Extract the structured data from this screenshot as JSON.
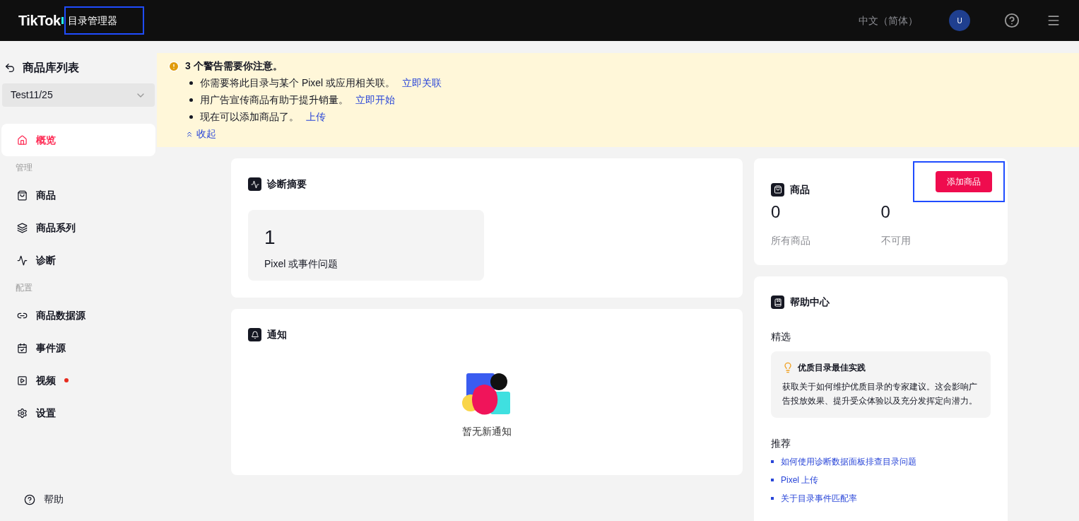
{
  "header": {
    "logo": "TikTok",
    "title": "目录管理器",
    "title_highlighted": true,
    "language": "中文（简体）",
    "avatar": "U"
  },
  "sidebar": {
    "back_label": "商品库列表",
    "catalog_select": "Test11/25",
    "items": [
      {
        "kind": "item",
        "label": "概览",
        "selected": true,
        "dot": false
      },
      {
        "kind": "section",
        "label": "管理"
      },
      {
        "kind": "item",
        "label": "商品",
        "selected": false,
        "dot": false
      },
      {
        "kind": "item",
        "label": "商品系列",
        "selected": false,
        "dot": false
      },
      {
        "kind": "item",
        "label": "诊断",
        "selected": false,
        "dot": false
      },
      {
        "kind": "section",
        "label": "配置"
      },
      {
        "kind": "item",
        "label": "商品数据源",
        "selected": false,
        "dot": false
      },
      {
        "kind": "item",
        "label": "事件源",
        "selected": false,
        "dot": false
      },
      {
        "kind": "item",
        "label": "视频",
        "selected": false,
        "dot": true
      },
      {
        "kind": "item",
        "label": "设置",
        "selected": false,
        "dot": false
      }
    ],
    "help": "帮助"
  },
  "alert": {
    "title": "3 个警告需要你注意。",
    "items": [
      {
        "text": "你需要将此目录与某个 Pixel 或应用相关联。",
        "link": "立即关联"
      },
      {
        "text": "用广告宣传商品有助于提升销量。",
        "link": "立即开始"
      },
      {
        "text": "现在可以添加商品了。",
        "link": "上传"
      }
    ],
    "collapse": "收起"
  },
  "diagnostics": {
    "title": "诊断摘要",
    "count": "1",
    "label": "Pixel 或事件问题"
  },
  "notifications": {
    "title": "通知",
    "empty": "暂无新通知"
  },
  "products": {
    "title": "商品",
    "add_button": "添加商品",
    "button_highlighted": true,
    "stats": [
      {
        "value": "0",
        "label": "所有商品"
      },
      {
        "value": "0",
        "label": "不可用"
      }
    ]
  },
  "help_center": {
    "title": "帮助中心",
    "featured_heading": "精选",
    "featured": {
      "title": "优质目录最佳实践",
      "body": "获取关于如何维护优质目录的专家建议。这会影响广告投放效果、提升受众体验以及充分发挥定向潜力。"
    },
    "recommended_heading": "推荐",
    "links": [
      "如何使用诊断数据面板排查目录问题",
      "Pixel 上传",
      "关于目录事件匹配率"
    ]
  }
}
